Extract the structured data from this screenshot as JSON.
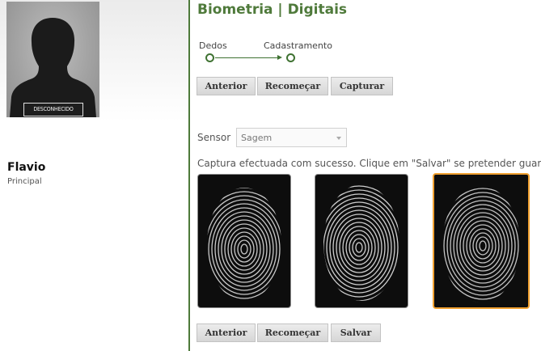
{
  "profile": {
    "photo_status": "DESCONHECIDO",
    "name": "Flavio",
    "role": "Principal"
  },
  "page": {
    "title": "Biometria | Digitais"
  },
  "steps": [
    {
      "label": "Dedos"
    },
    {
      "label": "Cadastramento"
    }
  ],
  "toolbar_top": {
    "previous": "Anterior",
    "restart": "Recomeçar",
    "capture": "Capturar"
  },
  "sensor": {
    "label": "Sensor",
    "selected": "Sagem"
  },
  "status_message": "Captura efectuada com sucesso. Clique em \"Salvar\" se pretender guardar",
  "fingerprints": {
    "count": 3,
    "selected_index": 2
  },
  "toolbar_bottom": {
    "previous": "Anterior",
    "restart": "Recomeçar",
    "save": "Salvar"
  },
  "colors": {
    "accent": "#4f7a3b",
    "selected_border": "#f0a030"
  }
}
